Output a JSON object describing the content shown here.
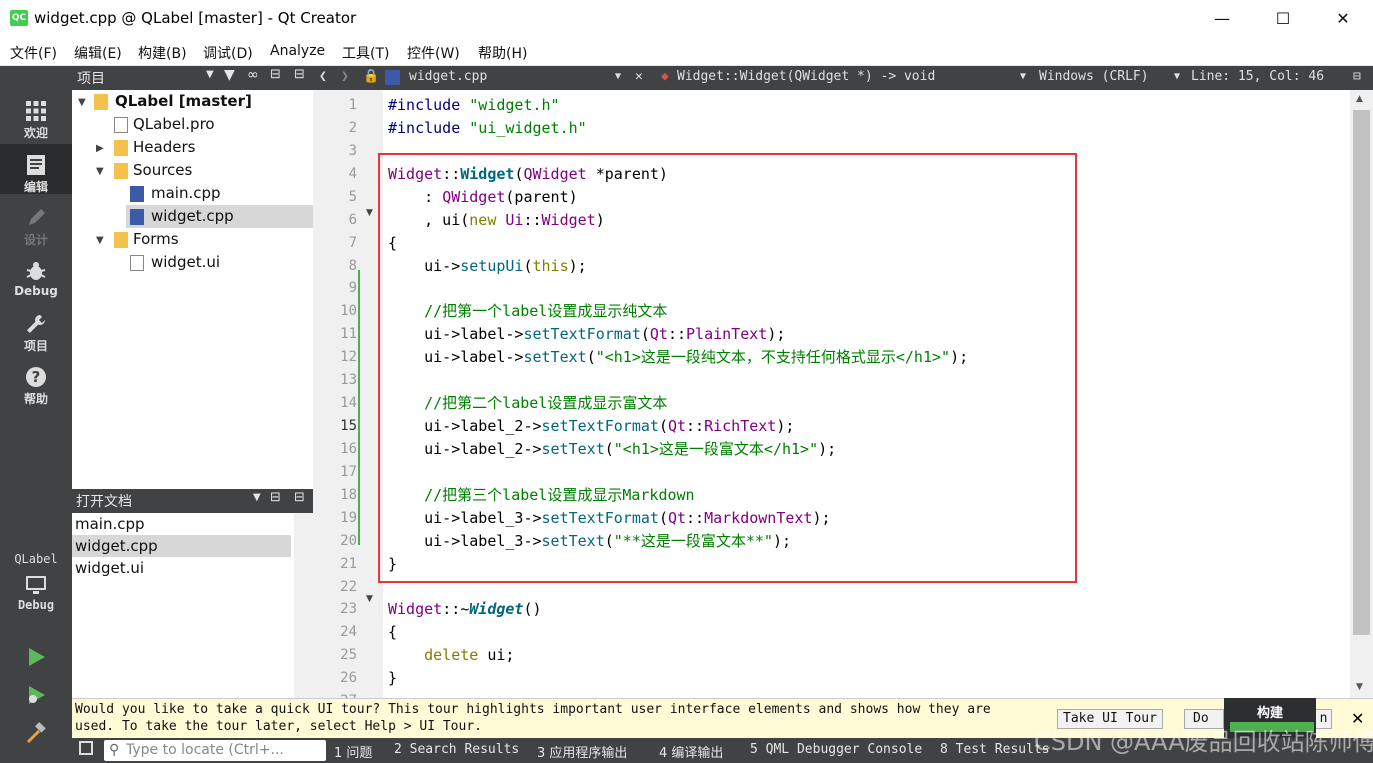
{
  "window": {
    "title": "widget.cpp @ QLabel [master] - Qt Creator",
    "app_icon": "QC"
  },
  "menu": [
    "文件(F)",
    "编辑(E)",
    "构建(B)",
    "调试(D)",
    "Analyze",
    "工具(T)",
    "控件(W)",
    "帮助(H)"
  ],
  "modes": [
    {
      "label": "欢迎",
      "icon": "grid-icon"
    },
    {
      "label": "编辑",
      "icon": "document-icon"
    },
    {
      "label": "设计",
      "icon": "pencil-icon"
    },
    {
      "label": "Debug",
      "icon": "bug-icon"
    },
    {
      "label": "项目",
      "icon": "wrench-icon"
    },
    {
      "label": "帮助",
      "icon": "help-icon"
    }
  ],
  "kit": {
    "name": "QLabel",
    "config": "Debug"
  },
  "project_panel": {
    "title": "项目",
    "tree": [
      {
        "label": "QLabel [master]",
        "level": 0,
        "bold": true
      },
      {
        "label": "QLabel.pro",
        "level": 1
      },
      {
        "label": "Headers",
        "level": 1
      },
      {
        "label": "Sources",
        "level": 1
      },
      {
        "label": "main.cpp",
        "level": 2
      },
      {
        "label": "widget.cpp",
        "level": 2,
        "selected": true
      },
      {
        "label": "Forms",
        "level": 1
      },
      {
        "label": "widget.ui",
        "level": 2
      }
    ]
  },
  "open_docs": {
    "title": "打开文档",
    "items": [
      "main.cpp",
      "widget.cpp",
      "widget.ui"
    ],
    "selected": 1
  },
  "editor_bar": {
    "file": "widget.cpp",
    "symbol": "Widget::Widget(QWidget *) -> void",
    "line_ending": "Windows (CRLF)",
    "position": "Line: 15, Col: 46"
  },
  "code": {
    "current_line": 15,
    "lines": [
      "#include \"widget.h\"",
      "#include \"ui_widget.h\"",
      "",
      "Widget::Widget(QWidget *parent)",
      "    : QWidget(parent)",
      "    , ui(new Ui::Widget)",
      "{",
      "    ui->setupUi(this);",
      "",
      "    //把第一个label设置成显示纯文本",
      "    ui->label->setTextFormat(Qt::PlainText);",
      "    ui->label->setText(\"<h1>这是一段纯文本，不支持任何格式显示</h1>\");",
      "",
      "    //把第二个label设置成显示富文本",
      "    ui->label_2->setTextFormat(Qt::RichText);",
      "    ui->label_2->setText(\"<h1>这是一段富文本</h1>\");",
      "",
      "    //把第三个label设置成显示Markdown",
      "    ui->label_3->setTextFormat(Qt::MarkdownText);",
      "    ui->label_3->setText(\"**这是一段富文本**\");",
      "}",
      "",
      "Widget::~Widget()",
      "{",
      "    delete ui;",
      "}",
      ""
    ]
  },
  "tour": {
    "text": "Would you like to take a quick UI tour? This tour highlights important user interface elements and shows how they are used. To take the tour later, select Help > UI Tour.",
    "take_button": "Take UI Tour",
    "dismiss_button": "Do N",
    "dismiss_tail": "n"
  },
  "build_popup": {
    "label": "构建"
  },
  "status": {
    "locator_placeholder": "Type to locate (Ctrl+...",
    "panes": [
      "1 问题",
      "2 Search Results",
      "3 应用程序输出",
      "4 编译输出",
      "5 QML Debugger Console",
      "8 Test Results"
    ]
  },
  "watermark": "CSDN @AAA废品回收站陈师傅",
  "colors": {
    "highlight_box": "#e0383e",
    "mode_bar": "#404244",
    "keyword": "#808000",
    "type": "#800080",
    "string": "#008000"
  }
}
